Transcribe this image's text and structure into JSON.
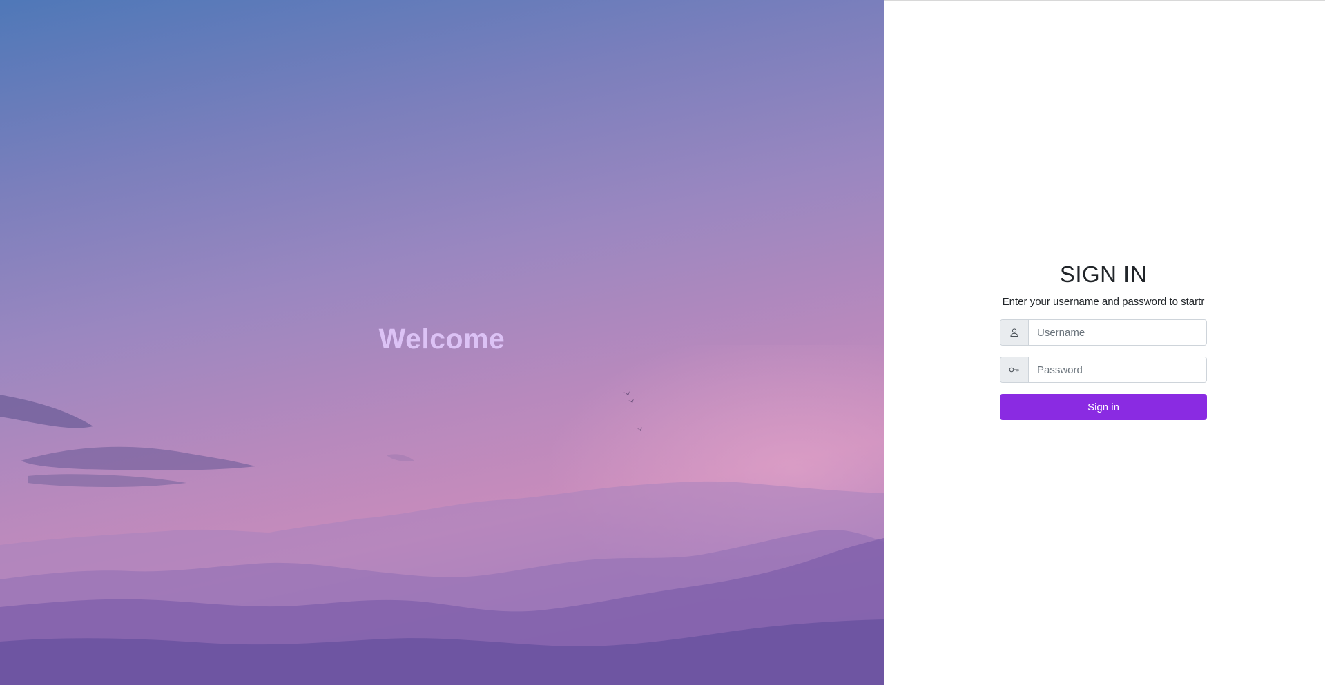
{
  "hero": {
    "welcome_text": "Welcome"
  },
  "signin": {
    "title": "SIGN IN",
    "subtitle": "Enter your username and password to startr",
    "username": {
      "icon": "user-icon",
      "placeholder": "Username",
      "value": ""
    },
    "password": {
      "icon": "key-icon",
      "placeholder": "Password",
      "value": ""
    },
    "submit_label": "Sign in"
  },
  "colors": {
    "accent": "#8a2be2",
    "welcome_text": "#dcc2f5",
    "panel_background": "#ffffff"
  }
}
